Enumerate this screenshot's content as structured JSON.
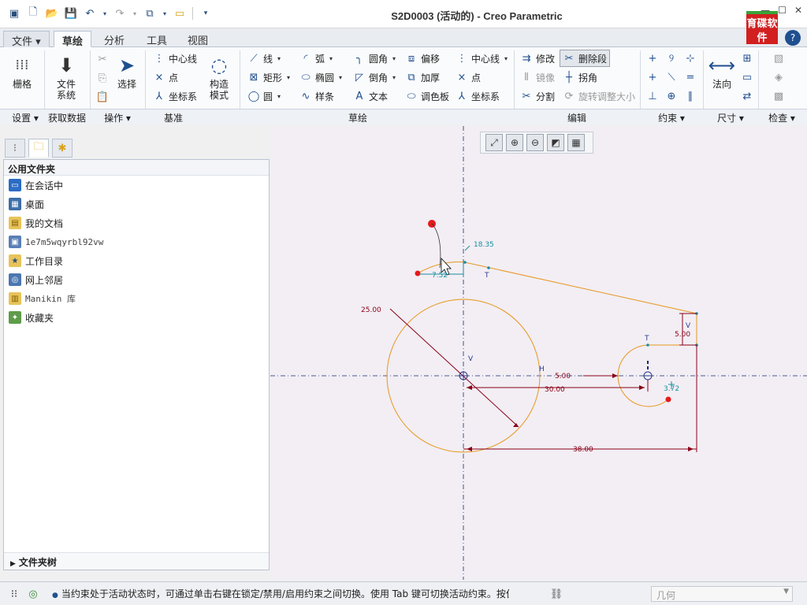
{
  "window": {
    "title": "S2D0003 (活动的) - Creo Parametric",
    "logo_text": "育碟软件"
  },
  "menu_tabs": [
    {
      "label": "文件 ▾"
    },
    {
      "label": "草绘"
    },
    {
      "label": "分析"
    },
    {
      "label": "工具"
    },
    {
      "label": "视图"
    }
  ],
  "ribbon": {
    "grid": "栅格",
    "file_system": "文件系统",
    "select": "选择",
    "centerline_datum": "中心线",
    "point_datum": "点",
    "csys_datum": "坐标系",
    "construction_mode": "构造模式",
    "line": "线",
    "rectangle": "矩形",
    "circle": "圆",
    "arc": "弧",
    "ellipse": "椭圆",
    "spline": "样条",
    "fillet": "圆角",
    "chamfer": "倒角",
    "text": "文本",
    "offset": "偏移",
    "thicken": "加厚",
    "palette": "调色板",
    "centerline": "中心线",
    "point": "点",
    "csys": "坐标系",
    "modify": "修改",
    "delete_segment": "删除段",
    "mirror": "镜像",
    "corner": "拐角",
    "divide": "分割",
    "rotate_resize": "旋转调整大小",
    "normal": "法向",
    "groups": {
      "setup": "设置 ▾",
      "get_data": "获取数据",
      "operations": "操作 ▾",
      "datum": "基准",
      "sketch": "草绘",
      "editing": "编辑",
      "constrain": "约束 ▾",
      "dimension": "尺寸 ▾",
      "inspect": "检查 ▾"
    }
  },
  "navigator": {
    "header": "公用文件夹",
    "items": [
      {
        "label": "在会话中",
        "icon": "monitor-icon"
      },
      {
        "label": "桌面",
        "icon": "desktop-icon"
      },
      {
        "label": "我的文档",
        "icon": "documents-icon"
      },
      {
        "label": "1e7m5wqyrbl92vw",
        "icon": "computer-icon"
      },
      {
        "label": "工作目录",
        "icon": "working-dir-icon"
      },
      {
        "label": "网上邻居",
        "icon": "network-icon"
      },
      {
        "label": "Manikin 库",
        "icon": "library-icon"
      },
      {
        "label": "收藏夹",
        "icon": "favorites-icon"
      }
    ],
    "footer": "文件夹树"
  },
  "sketch": {
    "dims": {
      "r_big": "25.00",
      "top_angle": "18.35",
      "left_small": "7.52",
      "d_5a": "5.00",
      "d_5b": "5.00",
      "d_30": "30.00",
      "d_38": "38.00",
      "d_372": "3.72"
    },
    "constraint_labels": {
      "t1": "T",
      "t2": "T",
      "v1": "V",
      "v2": "V",
      "h1": "H"
    },
    "colors": {
      "geometry": "#e8961c",
      "dimension": "#8b0016",
      "weak_dimension": "#1a8fa0",
      "background": "#f2eef4"
    }
  },
  "statusbar": {
    "message": "当约束处于活动状态时，可通过单击右键在锁定/禁用/启用约束之间切换。使用 Tab 键可切换活动约束。按住 Shift",
    "filter": "几何"
  }
}
